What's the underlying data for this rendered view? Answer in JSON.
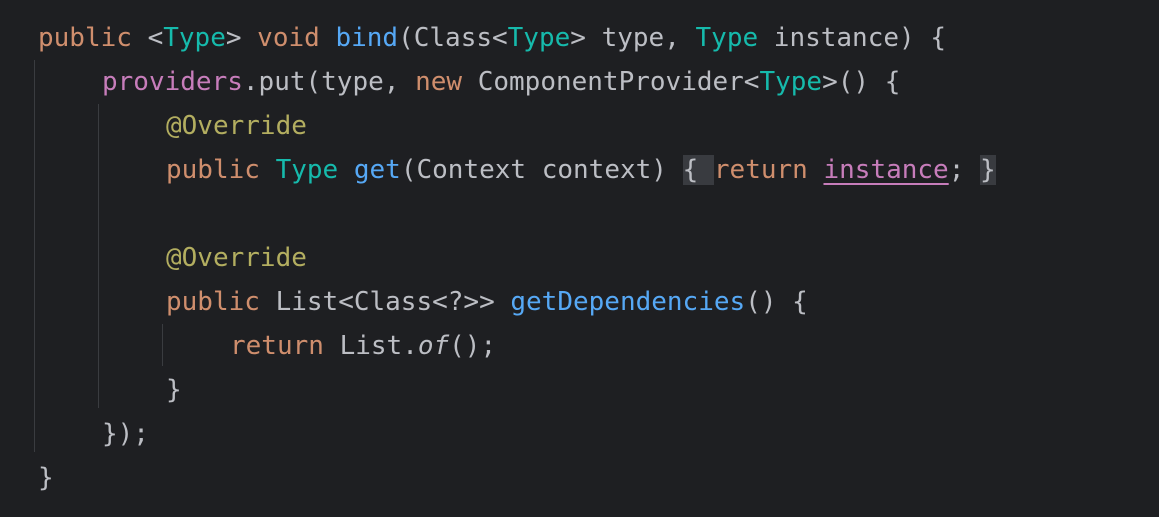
{
  "editor": {
    "lines": [
      {
        "indent": 0,
        "tokens": [
          {
            "t": "public",
            "c": "kw"
          },
          {
            "t": " <",
            "c": "pl"
          },
          {
            "t": "Type",
            "c": "ty"
          },
          {
            "t": "> ",
            "c": "pl"
          },
          {
            "t": "void",
            "c": "kw"
          },
          {
            "t": " ",
            "c": "pl"
          },
          {
            "t": "bind",
            "c": "fn"
          },
          {
            "t": "(Class<",
            "c": "pl"
          },
          {
            "t": "Type",
            "c": "ty"
          },
          {
            "t": "> type, ",
            "c": "pl"
          },
          {
            "t": "Type",
            "c": "ty"
          },
          {
            "t": " instance) {",
            "c": "pl"
          }
        ]
      },
      {
        "indent": 1,
        "tokens": [
          {
            "t": "providers",
            "c": "pf"
          },
          {
            "t": ".put(type, ",
            "c": "pl"
          },
          {
            "t": "new",
            "c": "kw"
          },
          {
            "t": " ComponentProvider<",
            "c": "pl"
          },
          {
            "t": "Type",
            "c": "ty"
          },
          {
            "t": ">() {",
            "c": "pl"
          }
        ]
      },
      {
        "indent": 2,
        "tokens": [
          {
            "t": "@Override",
            "c": "an"
          }
        ]
      },
      {
        "indent": 2,
        "tokens": [
          {
            "t": "public",
            "c": "kw"
          },
          {
            "t": " ",
            "c": "pl"
          },
          {
            "t": "Type",
            "c": "ty"
          },
          {
            "t": " ",
            "c": "pl"
          },
          {
            "t": "get",
            "c": "fn"
          },
          {
            "t": "(Context context) ",
            "c": "pl"
          },
          {
            "t": "{ ",
            "c": "pl fold"
          },
          {
            "t": "return",
            "c": "kw"
          },
          {
            "t": " ",
            "c": "pl"
          },
          {
            "t": "instance",
            "c": "pf ul"
          },
          {
            "t": "; ",
            "c": "pl"
          },
          {
            "t": "}",
            "c": "pl fold"
          }
        ]
      },
      {
        "indent": 0,
        "tokens": []
      },
      {
        "indent": 2,
        "tokens": [
          {
            "t": "@Override",
            "c": "an"
          }
        ]
      },
      {
        "indent": 2,
        "tokens": [
          {
            "t": "public",
            "c": "kw"
          },
          {
            "t": " List<Class<?>> ",
            "c": "pl"
          },
          {
            "t": "getDependencies",
            "c": "fn"
          },
          {
            "t": "() {",
            "c": "pl"
          }
        ]
      },
      {
        "indent": 3,
        "tokens": [
          {
            "t": "return",
            "c": "kw"
          },
          {
            "t": " List.",
            "c": "pl"
          },
          {
            "t": "of",
            "c": "pl it"
          },
          {
            "t": "();",
            "c": "pl"
          }
        ]
      },
      {
        "indent": 2,
        "tokens": [
          {
            "t": "}",
            "c": "pl"
          }
        ]
      },
      {
        "indent": 1,
        "tokens": [
          {
            "t": "});",
            "c": "pl"
          }
        ]
      },
      {
        "indent": 0,
        "tokens": [
          {
            "t": "}",
            "c": "pl"
          }
        ]
      }
    ]
  }
}
